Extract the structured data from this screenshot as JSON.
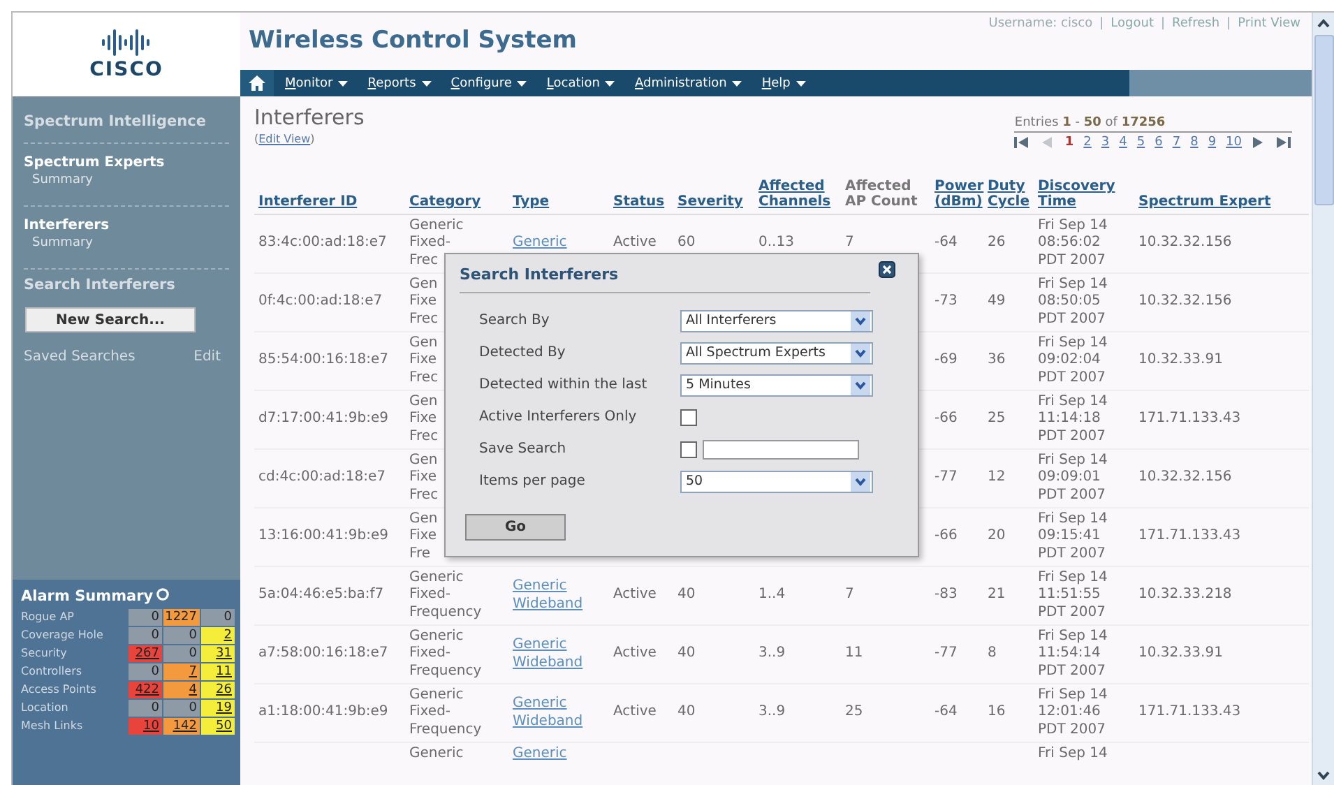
{
  "header": {
    "logo_text": "CISCO",
    "title": "Wireless Control System",
    "top_links": [
      {
        "kind": "text",
        "text": "Username: cisco"
      },
      {
        "kind": "separator",
        "text": "|"
      },
      {
        "kind": "link",
        "text": "Logout"
      },
      {
        "kind": "separator",
        "text": "|"
      },
      {
        "kind": "link",
        "text": "Refresh"
      },
      {
        "kind": "separator",
        "text": "|"
      },
      {
        "kind": "link",
        "text": "Print View"
      }
    ]
  },
  "nav": {
    "menus": [
      "Monitor",
      "Reports",
      "Configure",
      "Location",
      "Administration",
      "Help"
    ]
  },
  "sidebar": {
    "items": [
      {
        "kind": "header",
        "text": "Spectrum Intelligence"
      },
      {
        "kind": "divider"
      },
      {
        "kind": "section",
        "text": "Spectrum Experts"
      },
      {
        "kind": "link",
        "text": "Summary"
      },
      {
        "kind": "divider"
      },
      {
        "kind": "section",
        "text": "Interferers"
      },
      {
        "kind": "link",
        "text": "Summary"
      },
      {
        "kind": "divider"
      },
      {
        "kind": "header",
        "text": "Search Interferers"
      },
      {
        "kind": "button",
        "text": "New Search..."
      },
      {
        "kind": "pair",
        "text": "Saved Searches",
        "action": "Edit"
      }
    ]
  },
  "alarm_summary": {
    "title": "Alarm Summary",
    "rows": [
      {
        "label": "Rogue AP",
        "cells": [
          {
            "text": "0",
            "color": "#8e9ba6",
            "link": false
          },
          {
            "text": "1227",
            "color": "#f39a3e",
            "link": false
          },
          {
            "text": "0",
            "color": "#8e9ba6",
            "link": false
          }
        ]
      },
      {
        "label": "Coverage Hole",
        "cells": [
          {
            "text": "0",
            "color": "#8e9ba6",
            "link": false
          },
          {
            "text": "0",
            "color": "#8e9ba6",
            "link": false
          },
          {
            "text": "2",
            "color": "#f4ee3a",
            "link": true
          }
        ]
      },
      {
        "label": "Security",
        "cells": [
          {
            "text": "267",
            "color": "#e8443c",
            "link": true
          },
          {
            "text": "0",
            "color": "#8e9ba6",
            "link": false
          },
          {
            "text": "31",
            "color": "#f4ee3a",
            "link": true
          }
        ]
      },
      {
        "label": "Controllers",
        "cells": [
          {
            "text": "0",
            "color": "#8e9ba6",
            "link": false
          },
          {
            "text": "7",
            "color": "#f39a3e",
            "link": true
          },
          {
            "text": "11",
            "color": "#f4ee3a",
            "link": true
          }
        ]
      },
      {
        "label": "Access Points",
        "cells": [
          {
            "text": "422",
            "color": "#e8443c",
            "link": true
          },
          {
            "text": "4",
            "color": "#f39a3e",
            "link": true
          },
          {
            "text": "26",
            "color": "#f4ee3a",
            "link": true
          }
        ]
      },
      {
        "label": "Location",
        "cells": [
          {
            "text": "0",
            "color": "#8e9ba6",
            "link": false
          },
          {
            "text": "0",
            "color": "#8e9ba6",
            "link": false
          },
          {
            "text": "19",
            "color": "#f4ee3a",
            "link": true
          }
        ]
      },
      {
        "label": "Mesh Links",
        "cells": [
          {
            "text": "10",
            "color": "#e8443c",
            "link": true
          },
          {
            "text": "142",
            "color": "#f39a3e",
            "link": true
          },
          {
            "text": "50",
            "color": "#f4ee3a",
            "link": true
          }
        ]
      }
    ]
  },
  "main": {
    "title": "Interferers",
    "edit_view": {
      "before": "(",
      "link": "Edit View",
      "after": ")"
    },
    "pager": {
      "summary": "Entries **1** - **50** of **17256**",
      "buttons_before": [
        {
          "kind": "first",
          "disabled": false
        },
        {
          "kind": "prev",
          "disabled": true
        }
      ],
      "pages": [
        {
          "text": "1",
          "selected": true
        },
        {
          "text": "2",
          "selected": false
        },
        {
          "text": "3",
          "selected": false
        },
        {
          "text": "4",
          "selected": false
        },
        {
          "text": "5",
          "selected": false
        },
        {
          "text": "6",
          "selected": false
        },
        {
          "text": "7",
          "selected": false
        },
        {
          "text": "8",
          "selected": false
        },
        {
          "text": "9",
          "selected": false
        },
        {
          "text": "10",
          "selected": false
        }
      ],
      "buttons_after": [
        {
          "kind": "next",
          "disabled": false
        },
        {
          "kind": "last",
          "disabled": false
        }
      ]
    },
    "table": {
      "columns": [
        {
          "label": "Interferer ID",
          "sortable": true
        },
        {
          "label": "Category",
          "sortable": true
        },
        {
          "label": "Type",
          "sortable": true
        },
        {
          "label": "Status",
          "sortable": true
        },
        {
          "label": "Severity",
          "sortable": true
        },
        {
          "label": "Affected Channels",
          "sortable": true
        },
        {
          "label": "Affected AP Count",
          "sortable": false
        },
        {
          "label": "Power (dBm)",
          "sortable": true
        },
        {
          "label": "Duty Cycle",
          "sortable": true
        },
        {
          "label": "Discovery Time",
          "sortable": true
        },
        {
          "label": "Spectrum Expert",
          "sortable": true
        }
      ],
      "rows": [
        {
          "id": "83:4c:00:ad:18:e7",
          "category": "Generic\nFixed-\nFrec",
          "type": "Generic",
          "status": "Active",
          "severity": "60",
          "channels": "0..13",
          "ap_count": "7",
          "power": "-64",
          "duty": "26",
          "time": "Fri Sep 14\n08:56:02\nPDT 2007",
          "expert": "10.32.32.156"
        },
        {
          "id": "0f:4c:00:ad:18:e7",
          "category": "Gen\nFixe\nFrec",
          "power": "-73",
          "duty": "49",
          "time": "Fri Sep 14\n08:50:05\nPDT 2007",
          "expert": "10.32.32.156"
        },
        {
          "id": "85:54:00:16:18:e7",
          "category": "Gen\nFixe\nFrec",
          "power": "-69",
          "duty": "36",
          "time": "Fri Sep 14\n09:02:04\nPDT 2007",
          "expert": "10.32.33.91"
        },
        {
          "id": "d7:17:00:41:9b:e9",
          "category": "Gen\nFixe\nFrec",
          "power": "-66",
          "duty": "25",
          "time": "Fri Sep 14\n11:14:18\nPDT 2007",
          "expert": "171.71.133.43"
        },
        {
          "id": "cd:4c:00:ad:18:e7",
          "category": "Gen\nFixe\nFrec",
          "power": "-77",
          "duty": "12",
          "time": "Fri Sep 14\n09:09:01\nPDT 2007",
          "expert": "10.32.32.156"
        },
        {
          "id": "13:16:00:41:9b:e9",
          "category": "Gen\nFixe\nFre",
          "power": "-66",
          "duty": "20",
          "time": "Fri Sep 14\n09:15:41\nPDT 2007",
          "expert": "171.71.133.43"
        },
        {
          "id": "5a:04:46:e5:ba:f7",
          "category": "Generic\nFixed-\nFrequency",
          "type": "Generic\nWideband",
          "status": "Active",
          "severity": "40",
          "channels": "1..4",
          "ap_count": "7",
          "power": "-83",
          "duty": "21",
          "time": "Fri Sep 14\n11:51:55\nPDT 2007",
          "expert": "10.32.33.218"
        },
        {
          "id": "a7:58:00:16:18:e7",
          "category": "Generic\nFixed-\nFrequency",
          "type": "Generic\nWideband",
          "status": "Active",
          "severity": "40",
          "channels": "3..9",
          "ap_count": "11",
          "power": "-77",
          "duty": "8",
          "time": "Fri Sep 14\n11:54:14\nPDT 2007",
          "expert": "10.32.33.91"
        },
        {
          "id": "a1:18:00:41:9b:e9",
          "category": "Generic\nFixed-\nFrequency",
          "type": "Generic\nWideband",
          "status": "Active",
          "severity": "40",
          "channels": "3..9",
          "ap_count": "25",
          "power": "-64",
          "duty": "16",
          "time": "Fri Sep 14\n12:01:46\nPDT 2007",
          "expert": "171.71.133.43"
        },
        {
          "category": "Generic",
          "type": "Generic",
          "time": "Fri Sep 14"
        }
      ]
    }
  },
  "dialog": {
    "title": "Search Interferers",
    "fields": [
      {
        "kind": "select",
        "label": "Search By",
        "value": "All Interferers"
      },
      {
        "kind": "select",
        "label": "Detected By",
        "value": "All Spectrum Experts"
      },
      {
        "kind": "select",
        "label": "Detected within the last",
        "value": "5 Minutes"
      },
      {
        "kind": "checkbox",
        "label": "Active Interferers Only",
        "checked": false
      },
      {
        "kind": "checkbox_text",
        "label": "Save Search",
        "checked": false
      },
      {
        "kind": "select",
        "label": "Items per page",
        "value": "50"
      }
    ],
    "button": "Go"
  }
}
